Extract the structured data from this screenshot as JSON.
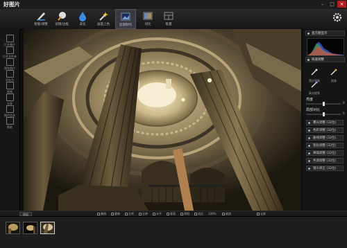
{
  "app": {
    "title": "好图片"
  },
  "window": {
    "min": "–",
    "max": "□",
    "close": "×"
  },
  "toolbar": {
    "items": [
      {
        "label": "智能/调整",
        "icon": "pen-icon"
      },
      {
        "label": "滤镜/边框",
        "icon": "brush-icon"
      },
      {
        "label": "美化",
        "icon": "drop-icon"
      },
      {
        "label": "画面上色",
        "icon": "wand-icon"
      },
      {
        "label": "后期制作",
        "icon": "image-icon"
      },
      {
        "label": "对比",
        "icon": "compare-icon"
      },
      {
        "label": "批量",
        "icon": "grid-icon"
      }
    ],
    "settings_icon": "gear-icon"
  },
  "leftbar": {
    "items": [
      {
        "label": "打开图片"
      },
      {
        "label": "打开文件夹"
      },
      {
        "label": "保存图片"
      },
      {
        "label": "另存为"
      },
      {
        "label": "视频"
      },
      {
        "label": "分享"
      },
      {
        "label": "图片信息"
      },
      {
        "label": "帮助"
      }
    ]
  },
  "rightpanel": {
    "histogram_header": "直方图显示",
    "tools_header": "快速调整",
    "tools": [
      {
        "label": "黑白平衡"
      },
      {
        "label": "校准"
      },
      {
        "label": "高光提亮"
      }
    ],
    "sliders": [
      {
        "label": "亮度",
        "value": "0",
        "level": 0.5
      },
      {
        "label": "局部对比",
        "value": "0",
        "level": 0.5
      }
    ],
    "buttons": [
      {
        "label": "曝光调整 (32位)"
      },
      {
        "label": "色阶调整 (32位)"
      },
      {
        "label": "曲线调整 (32位)"
      },
      {
        "label": "锐化调整 (32位)"
      },
      {
        "label": "降噪调整 (32位)"
      },
      {
        "label": "色调调整 (32位)"
      },
      {
        "label": "镜头矫正 (32位)"
      }
    ]
  },
  "statusbar": {
    "expand": "收起",
    "items": [
      "撤销",
      "重做",
      "左转",
      "右转",
      "水平",
      "垂直",
      "原图",
      "适应",
      "100%",
      "缩放",
      "全屏"
    ]
  },
  "filmstrip": {
    "count": 3
  }
}
